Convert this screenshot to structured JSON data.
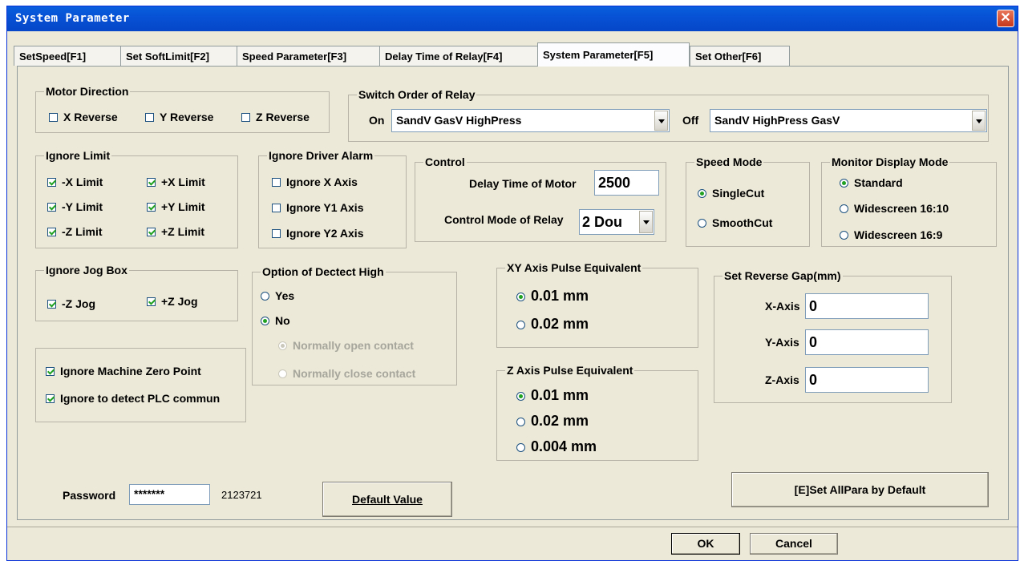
{
  "window": {
    "title": "System Parameter"
  },
  "tabs": [
    {
      "label": "SetSpeed[F1]"
    },
    {
      "label": "Set SoftLimit[F2]"
    },
    {
      "label": "Speed Parameter[F3]"
    },
    {
      "label": "Delay Time of Relay[F4]"
    },
    {
      "label": "System Parameter[F5]"
    },
    {
      "label": "Set Other[F6]"
    }
  ],
  "motor_direction": {
    "title": "Motor Direction",
    "x": "X Reverse",
    "y": "Y Reverse",
    "z": "Z Reverse"
  },
  "switch_order": {
    "title": "Switch Order of Relay",
    "on_label": "On",
    "on_value": "SandV GasV HighPress",
    "off_label": "Off",
    "off_value": "SandV HighPress GasV"
  },
  "ignore_limit": {
    "title": "Ignore Limit",
    "neg_x": "-X Limit",
    "pos_x": "+X Limit",
    "neg_y": "-Y Limit",
    "pos_y": "+Y Limit",
    "neg_z": "-Z Limit",
    "pos_z": "+Z Limit"
  },
  "ignore_driver": {
    "title": "Ignore Driver Alarm",
    "x": "Ignore X Axis",
    "y1": "Ignore Y1 Axis",
    "y2": "Ignore Y2 Axis"
  },
  "control": {
    "title": "Control",
    "delay_label": "Delay Time of Motor",
    "delay_value": "2500",
    "mode_label": "Control Mode of Relay",
    "mode_value": "2 Dou"
  },
  "speed_mode": {
    "title": "Speed Mode",
    "single": "SingleCut",
    "smooth": "SmoothCut"
  },
  "monitor": {
    "title": "Monitor Display Mode",
    "standard": "Standard",
    "w1610": "Widescreen 16:10",
    "w169": "Widescreen 16:9"
  },
  "jog": {
    "title": "Ignore Jog Box",
    "neg_z": "-Z Jog",
    "pos_z": "+Z Jog"
  },
  "detect_high": {
    "title": "Option of Dectect High",
    "yes": "Yes",
    "no": "No",
    "open": "Normally open contact",
    "close": "Normally close contact"
  },
  "xy_pulse": {
    "title": "XY Axis Pulse Equivalent",
    "opt1": "0.01 mm",
    "opt2": "0.02 mm"
  },
  "z_pulse": {
    "title": "Z Axis Pulse Equivalent",
    "opt1": "0.01 mm",
    "opt2": "0.02 mm",
    "opt3": "0.004 mm"
  },
  "reverse_gap": {
    "title": "Set Reverse Gap(mm)",
    "x_label": "X-Axis",
    "x_value": "0",
    "y_label": "Y-Axis",
    "y_value": "0",
    "z_label": "Z-Axis",
    "z_value": "0"
  },
  "misc": {
    "ignore_zero": "Ignore Machine Zero Point",
    "ignore_plc": "Ignore to detect PLC commun"
  },
  "password": {
    "label": "Password",
    "value": "*******",
    "code": "2123721"
  },
  "buttons": {
    "default_value": "Default Value",
    "set_all": "[E]Set AllPara by Default",
    "ok": "OK",
    "cancel": "Cancel"
  }
}
